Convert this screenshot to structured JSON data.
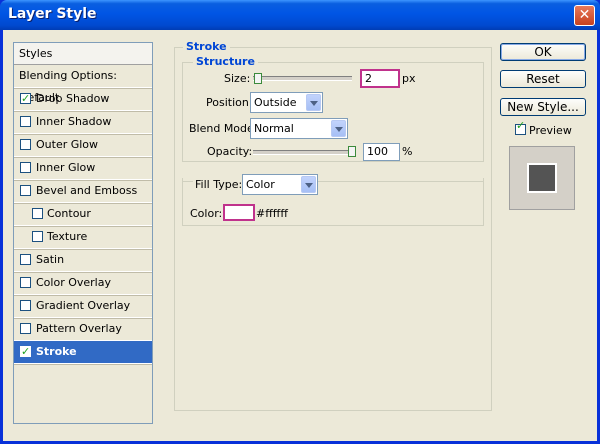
{
  "window": {
    "title": "Layer Style",
    "close_label": "✕"
  },
  "sidebar": {
    "header": "Styles",
    "items": [
      {
        "label": "Blending Options: Default",
        "type": "blend"
      },
      {
        "label": "Drop Shadow",
        "checked": true
      },
      {
        "label": "Inner Shadow",
        "checked": false
      },
      {
        "label": "Outer Glow",
        "checked": false
      },
      {
        "label": "Inner Glow",
        "checked": false
      },
      {
        "label": "Bevel and Emboss",
        "checked": false
      },
      {
        "label": "Contour",
        "checked": false,
        "indent": true
      },
      {
        "label": "Texture",
        "checked": false,
        "indent": true
      },
      {
        "label": "Satin",
        "checked": false
      },
      {
        "label": "Color Overlay",
        "checked": false
      },
      {
        "label": "Gradient Overlay",
        "checked": false
      },
      {
        "label": "Pattern Overlay",
        "checked": false
      },
      {
        "label": "Stroke",
        "checked": true,
        "selected": true
      }
    ]
  },
  "stroke": {
    "title": "Stroke",
    "structure_title": "Structure",
    "size_label": "Size:",
    "size_value": "2",
    "size_unit": "px",
    "size_level": 0.01,
    "position_label": "Position:",
    "position_value": "Outside",
    "blend_mode_label": "Blend Mode:",
    "blend_mode_value": "Normal",
    "opacity_label": "Opacity:",
    "opacity_value": "100",
    "opacity_unit": "%",
    "opacity_level": 1.0,
    "fill_type_label": "Fill Type:",
    "fill_type_value": "Color",
    "color_label": "Color:",
    "color_hex": "#ffffff"
  },
  "buttons": {
    "ok": "OK",
    "reset": "Reset",
    "new_style": "New Style...",
    "preview_label": "Preview"
  },
  "colors": {
    "selection": "#316ac5",
    "accent": "#c0328c",
    "group_title": "#0046d5"
  }
}
